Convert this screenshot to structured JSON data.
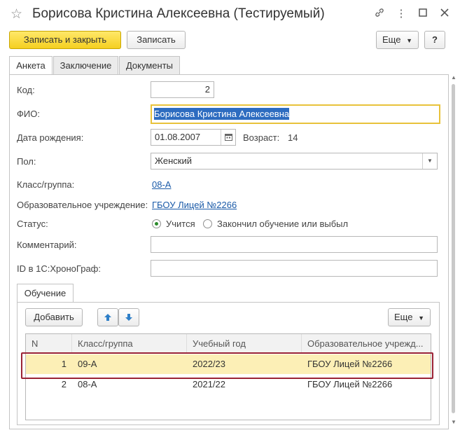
{
  "window": {
    "title": "Борисова Кристина Алексеевна (Тестируемый)",
    "star_icon": "star-icon",
    "link_icon": "link-icon",
    "menu_icon": "more-vertical-icon",
    "maximize_icon": "maximize-icon",
    "close_icon": "close-icon"
  },
  "toolbar": {
    "save_close_label": "Записать и закрыть",
    "save_label": "Записать",
    "more_label": "Еще",
    "help_label": "?"
  },
  "tabs": [
    {
      "label": "Анкета"
    },
    {
      "label": "Заключение"
    },
    {
      "label": "Документы"
    }
  ],
  "form": {
    "code_label": "Код:",
    "code_value": "2",
    "fio_label": "ФИО:",
    "fio_value": "Борисова Кристина Алексеевна",
    "birth_label": "Дата рождения:",
    "birth_value": "01.08.2007",
    "age_label": "Возраст:",
    "age_value": "14",
    "sex_label": "Пол:",
    "sex_value": "Женский",
    "class_label": "Класс/группа:",
    "class_value": "08-А",
    "school_label": "Образовательное учреждение:",
    "school_value": "ГБОУ Лицей №2266",
    "status_label": "Статус:",
    "status_option1": "Учится",
    "status_option2": "Закончил обучение или выбыл",
    "comment_label": "Комментарий:",
    "comment_value": "",
    "chrono_label": "ID в 1С:ХроноГраф:",
    "chrono_value": ""
  },
  "education": {
    "tab_label": "Обучение",
    "add_label": "Добавить",
    "more_label": "Еще",
    "columns": [
      "N",
      "Класс/группа",
      "Учебный год",
      "Образовательное учрежд..."
    ],
    "rows": [
      {
        "n": "1",
        "class": "09-А",
        "year": "2022/23",
        "school": "ГБОУ Лицей №2266"
      },
      {
        "n": "2",
        "class": "08-А",
        "year": "2021/22",
        "school": "ГБОУ Лицей №2266"
      }
    ]
  },
  "colors": {
    "accent_yellow": "#f5d020",
    "link": "#1a5aa8",
    "focus_border": "#e8c23a",
    "selection": "#fcefb6",
    "highlight_frame": "#9b2335"
  }
}
